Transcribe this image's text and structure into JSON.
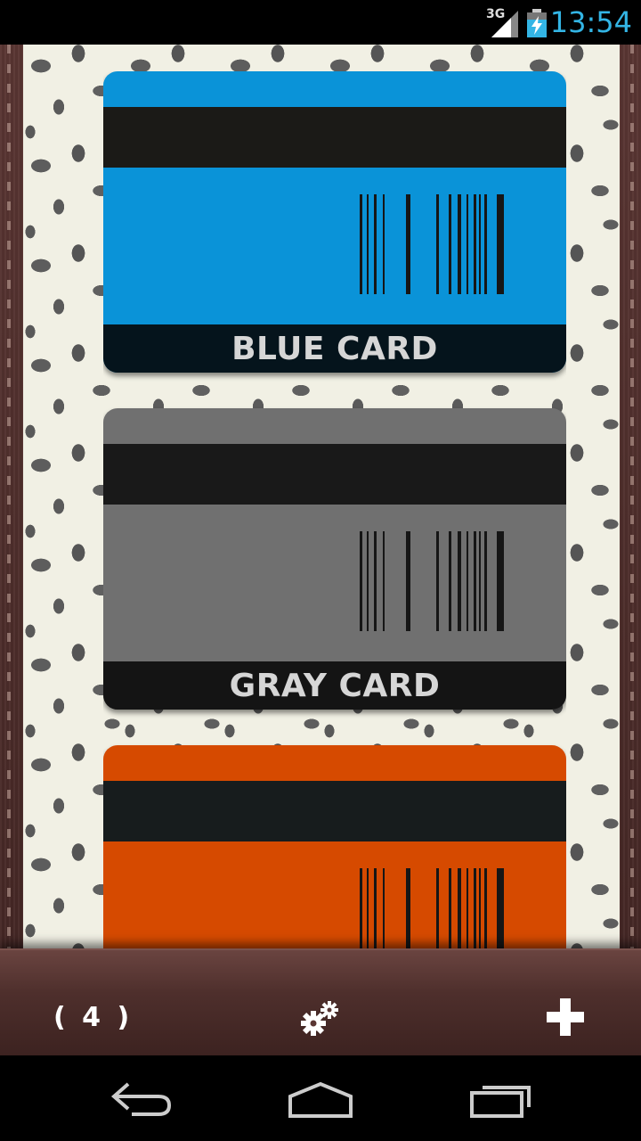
{
  "status_bar": {
    "network": "3G",
    "time": "13:54",
    "icons": [
      "signal-icon",
      "battery-charging-icon"
    ]
  },
  "cards": [
    {
      "label": "BLUE CARD",
      "color": "#0a93d8",
      "stripe_color": "#1b1a17",
      "band_color": "#05141c"
    },
    {
      "label": "GRAY CARD",
      "color": "#707070",
      "stripe_color": "#191919",
      "band_color": "#141414"
    },
    {
      "label": "",
      "color": "#d64a00",
      "stripe_color": "#171c1d",
      "band_color": "#141414"
    }
  ],
  "toolbar": {
    "card_count": "( 4 )",
    "settings_icon": "gears-icon",
    "add_icon": "plus-icon"
  },
  "nav_bar": {
    "icons": [
      "back-icon",
      "home-icon",
      "recent-apps-icon"
    ]
  },
  "colors": {
    "clock": "#33b5e5",
    "leather": "#4a2c2a",
    "leopard_bg": "#f1f0e4"
  }
}
